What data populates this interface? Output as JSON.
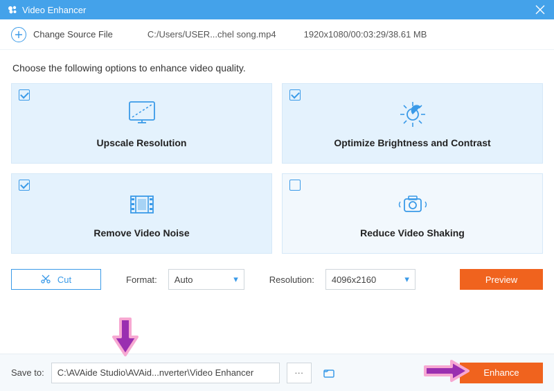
{
  "titlebar": {
    "title": "Video Enhancer"
  },
  "source": {
    "change_label": "Change Source File",
    "path": "C:/Users/USER...chel song.mp4",
    "stats": "1920x1080/00:03:29/38.61 MB"
  },
  "instruction": "Choose the following options to enhance video quality.",
  "options": [
    {
      "label": "Upscale Resolution",
      "checked": true
    },
    {
      "label": "Optimize Brightness and Contrast",
      "checked": true
    },
    {
      "label": "Remove Video Noise",
      "checked": true
    },
    {
      "label": "Reduce Video Shaking",
      "checked": false
    }
  ],
  "toolbar": {
    "cut_label": "Cut",
    "format_label": "Format:",
    "format_value": "Auto",
    "resolution_label": "Resolution:",
    "resolution_value": "4096x2160",
    "preview_label": "Preview"
  },
  "save": {
    "label": "Save to:",
    "path": "C:\\AVAide Studio\\AVAid...nverter\\Video Enhancer",
    "dots": "···",
    "enhance_label": "Enhance"
  }
}
